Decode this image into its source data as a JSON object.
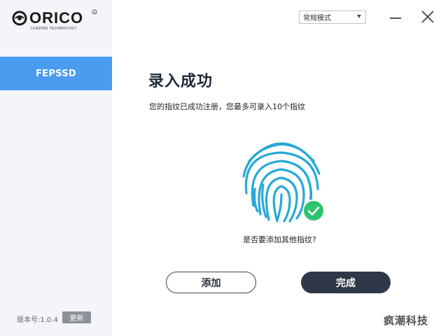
{
  "app": {
    "brand_text": "ORICO",
    "brand_tagline": "LEADING TECHNOLOGY",
    "accent_color": "#4a9cf0",
    "dark_button_color": "#2e3848",
    "success_color": "#2ec46f"
  },
  "sidebar": {
    "items": [
      {
        "label": "FEPSSD",
        "active": true
      }
    ],
    "version_label": "版本号:1.0.4",
    "update_label": "更新"
  },
  "topbar": {
    "mode_select_value": "常规模式",
    "minimize_icon": "minimize-icon",
    "close_icon": "close-icon"
  },
  "main": {
    "title": "录入成功",
    "subtitle": "您的指纹已成功注册，您最多可录入10个指纹",
    "fingerprint_icon": "fingerprint-icon",
    "success_icon": "checkmark-icon",
    "question": "是否要添加其他指纹?",
    "add_label": "添加",
    "done_label": "完成"
  },
  "watermark": "疯潮科技"
}
